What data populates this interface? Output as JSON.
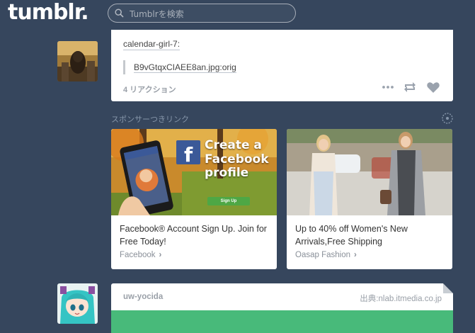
{
  "header": {
    "logo": "tumblr.",
    "search_placeholder": "Tumblrを検索"
  },
  "post1": {
    "blog_name": "calendar-girl-7:",
    "quote_text": "B9vGtqxCIAEE8an.jpg:orig",
    "notes": "4 リアクション",
    "controls": [
      "more-icon",
      "reblog-icon",
      "like-icon"
    ]
  },
  "sponsored": {
    "label": "スポンサーつきリンク",
    "ads": [
      {
        "title": "Facebook® Account Sign Up. Join for Free Today!",
        "source": "Facebook",
        "image_text": "Create a Facebook profile",
        "image_button": "Sign Up"
      },
      {
        "title": "Up to 40% off Women's New Arrivals,Free Shipping",
        "source": "Oasap Fashion"
      }
    ]
  },
  "post2": {
    "blog_name": "uw-yocida",
    "source": "出典:nlab.itmedia.co.jp"
  },
  "colors": {
    "background": "#36465d",
    "card": "#ffffff",
    "accent_green": "#48ba7a"
  }
}
